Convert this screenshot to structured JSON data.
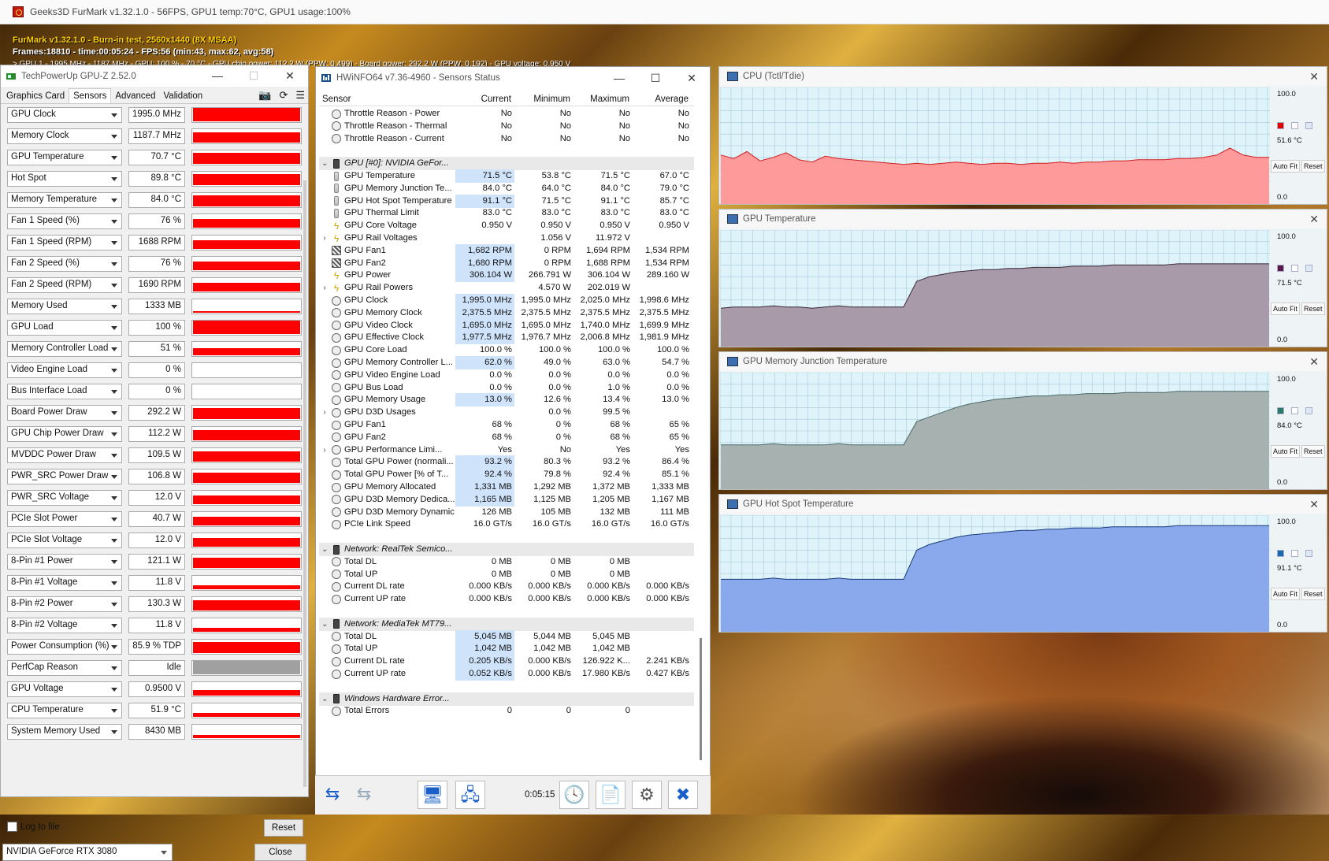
{
  "furmark": {
    "title": "Geeks3D FurMark v1.32.1.0 - 56FPS, GPU1 temp:70°C, GPU1 usage:100%",
    "osd_line1": "FurMark v1.32.1.0 - Burn-in test, 2560x1440 (8X MSAA)",
    "osd_line2": "Frames:18810 - time:00:05:24 - FPS:56 (min:43, max:62, avg:58)",
    "osd_line3": "> GPU 1 - 1995 MHz - 1187 MHz - GPU: 100 % - 70 °C - GPU chip power: 112.2 W (PPW: 0.499) - Board power: 292.2 W (PPW: 0.192) - GPU voltage: 0.950 V"
  },
  "gpuz": {
    "title": "TechPowerUp GPU-Z 2.52.0",
    "tabs": [
      "Graphics Card",
      "Sensors",
      "Advanced",
      "Validation"
    ],
    "sensors": [
      {
        "name": "GPU Clock",
        "value": "1995.0 MHz",
        "level": 0.92,
        "color": "red"
      },
      {
        "name": "Memory Clock",
        "value": "1187.7 MHz",
        "level": 0.7,
        "color": "red"
      },
      {
        "name": "GPU Temperature",
        "value": "70.7 °C",
        "level": 0.75,
        "color": "red"
      },
      {
        "name": "Hot Spot",
        "value": "89.8 °C",
        "level": 0.8,
        "color": "red"
      },
      {
        "name": "Memory Temperature",
        "value": "84.0 °C",
        "level": 0.75,
        "color": "red"
      },
      {
        "name": "Fan 1 Speed (%)",
        "value": "76 %",
        "level": 0.6,
        "color": "red"
      },
      {
        "name": "Fan 1 Speed (RPM)",
        "value": "1688 RPM",
        "level": 0.6,
        "color": "red"
      },
      {
        "name": "Fan 2 Speed (%)",
        "value": "76 %",
        "level": 0.6,
        "color": "red"
      },
      {
        "name": "Fan 2 Speed (RPM)",
        "value": "1690 RPM",
        "level": 0.6,
        "color": "red"
      },
      {
        "name": "Memory Used",
        "value": "1333 MB",
        "level": 0.1,
        "color": "red"
      },
      {
        "name": "GPU Load",
        "value": "100 %",
        "level": 0.92,
        "color": "red"
      },
      {
        "name": "Memory Controller Load",
        "value": "51 %",
        "level": 0.5,
        "color": "red"
      },
      {
        "name": "Video Engine Load",
        "value": "0 %",
        "level": 0.0,
        "color": "red"
      },
      {
        "name": "Bus Interface Load",
        "value": "0 %",
        "level": 0.0,
        "color": "red"
      },
      {
        "name": "Board Power Draw",
        "value": "292.2 W",
        "level": 0.75,
        "color": "red"
      },
      {
        "name": "GPU Chip Power Draw",
        "value": "112.2 W",
        "level": 0.7,
        "color": "red"
      },
      {
        "name": "MVDDC Power Draw",
        "value": "109.5 W",
        "level": 0.7,
        "color": "red"
      },
      {
        "name": "PWR_SRC Power Draw",
        "value": "106.8 W",
        "level": 0.7,
        "color": "red"
      },
      {
        "name": "PWR_SRC Voltage",
        "value": "12.0 V",
        "level": 0.6,
        "color": "red"
      },
      {
        "name": "PCIe Slot Power",
        "value": "40.7 W",
        "level": 0.6,
        "color": "red"
      },
      {
        "name": "PCIe Slot Voltage",
        "value": "12.0 V",
        "level": 0.6,
        "color": "red"
      },
      {
        "name": "8-Pin #1 Power",
        "value": "121.1 W",
        "level": 0.7,
        "color": "red"
      },
      {
        "name": "8-Pin #1 Voltage",
        "value": "11.8 V",
        "level": 0.3,
        "color": "red"
      },
      {
        "name": "8-Pin #2 Power",
        "value": "130.3 W",
        "level": 0.7,
        "color": "red"
      },
      {
        "name": "8-Pin #2 Voltage",
        "value": "11.8 V",
        "level": 0.3,
        "color": "red"
      },
      {
        "name": "Power Consumption (%)",
        "value": "85.9 % TDP",
        "level": 0.75,
        "color": "red"
      },
      {
        "name": "PerfCap Reason",
        "value": "Idle",
        "level": 0.92,
        "color": "gray"
      },
      {
        "name": "GPU Voltage",
        "value": "0.9500 V",
        "level": 0.4,
        "color": "red"
      },
      {
        "name": "CPU Temperature",
        "value": "51.9 °C",
        "level": 0.3,
        "color": "red"
      },
      {
        "name": "System Memory Used",
        "value": "8430 MB",
        "level": 0.2,
        "color": "red"
      }
    ],
    "log_label": "Log to file",
    "reset_label": "Reset",
    "device": "NVIDIA GeForce RTX 3080",
    "close_label": "Close"
  },
  "hwinfo": {
    "title": "HWiNFO64 v7.36-4960 - Sensors Status",
    "columns": [
      "Sensor",
      "Current",
      "Minimum",
      "Maximum",
      "Average"
    ],
    "rows": [
      {
        "t": "row",
        "icon": "circle",
        "n": "Throttle Reason - Power",
        "c": "No",
        "mi": "No",
        "ma": "No",
        "av": "No"
      },
      {
        "t": "row",
        "icon": "circle",
        "n": "Throttle Reason - Thermal",
        "c": "No",
        "mi": "No",
        "ma": "No",
        "av": "No"
      },
      {
        "t": "row",
        "icon": "circle",
        "n": "Throttle Reason - Current",
        "c": "No",
        "mi": "No",
        "ma": "No",
        "av": "No"
      },
      {
        "t": "blank"
      },
      {
        "t": "grp",
        "n": "GPU [#0]: NVIDIA GeFor..."
      },
      {
        "t": "row",
        "icon": "th",
        "n": "GPU Temperature",
        "c": "71.5 °C",
        "mi": "53.8 °C",
        "ma": "71.5 °C",
        "av": "67.0 °C",
        "hl": true
      },
      {
        "t": "row",
        "icon": "th",
        "n": "GPU Memory Junction Te...",
        "c": "84.0 °C",
        "mi": "64.0 °C",
        "ma": "84.0 °C",
        "av": "79.0 °C"
      },
      {
        "t": "row",
        "icon": "th",
        "n": "GPU Hot Spot Temperature",
        "c": "91.1 °C",
        "mi": "71.5 °C",
        "ma": "91.1 °C",
        "av": "85.7 °C",
        "hl": true
      },
      {
        "t": "row",
        "icon": "th",
        "n": "GPU Thermal Limit",
        "c": "83.0 °C",
        "mi": "83.0 °C",
        "ma": "83.0 °C",
        "av": "83.0 °C"
      },
      {
        "t": "row",
        "icon": "bolt",
        "n": "GPU Core Voltage",
        "c": "0.950 V",
        "mi": "0.950 V",
        "ma": "0.950 V",
        "av": "0.950 V"
      },
      {
        "t": "row",
        "icon": "bolt",
        "n": "GPU Rail Voltages",
        "c": "",
        "mi": "1.056 V",
        "ma": "11.972 V",
        "av": "",
        "ex": true
      },
      {
        "t": "row",
        "icon": "fan",
        "n": "GPU Fan1",
        "c": "1,682 RPM",
        "mi": "0 RPM",
        "ma": "1,694 RPM",
        "av": "1,534 RPM",
        "hl": true
      },
      {
        "t": "row",
        "icon": "fan",
        "n": "GPU Fan2",
        "c": "1,680 RPM",
        "mi": "0 RPM",
        "ma": "1,688 RPM",
        "av": "1,534 RPM",
        "hl": true
      },
      {
        "t": "row",
        "icon": "bolt",
        "n": "GPU Power",
        "c": "306.104 W",
        "mi": "266.791 W",
        "ma": "306.104 W",
        "av": "289.160 W",
        "hl": true
      },
      {
        "t": "row",
        "icon": "bolt",
        "n": "GPU Rail Powers",
        "c": "",
        "mi": "4.570 W",
        "ma": "202.019 W",
        "av": "",
        "ex": true
      },
      {
        "t": "row",
        "icon": "circle",
        "n": "GPU Clock",
        "c": "1,995.0 MHz",
        "mi": "1,995.0 MHz",
        "ma": "2,025.0 MHz",
        "av": "1,998.6 MHz",
        "hl": true
      },
      {
        "t": "row",
        "icon": "circle",
        "n": "GPU Memory Clock",
        "c": "2,375.5 MHz",
        "mi": "2,375.5 MHz",
        "ma": "2,375.5 MHz",
        "av": "2,375.5 MHz",
        "hl": true
      },
      {
        "t": "row",
        "icon": "circle",
        "n": "GPU Video Clock",
        "c": "1,695.0 MHz",
        "mi": "1,695.0 MHz",
        "ma": "1,740.0 MHz",
        "av": "1,699.9 MHz",
        "hl": true
      },
      {
        "t": "row",
        "icon": "circle",
        "n": "GPU Effective Clock",
        "c": "1,977.5 MHz",
        "mi": "1,976.7 MHz",
        "ma": "2,006.8 MHz",
        "av": "1,981.9 MHz",
        "hl": true
      },
      {
        "t": "row",
        "icon": "circle",
        "n": "GPU Core Load",
        "c": "100.0 %",
        "mi": "100.0 %",
        "ma": "100.0 %",
        "av": "100.0 %"
      },
      {
        "t": "row",
        "icon": "circle",
        "n": "GPU Memory Controller L...",
        "c": "62.0 %",
        "mi": "49.0 %",
        "ma": "63.0 %",
        "av": "54.7 %",
        "hl": true
      },
      {
        "t": "row",
        "icon": "circle",
        "n": "GPU Video Engine Load",
        "c": "0.0 %",
        "mi": "0.0 %",
        "ma": "0.0 %",
        "av": "0.0 %"
      },
      {
        "t": "row",
        "icon": "circle",
        "n": "GPU Bus Load",
        "c": "0.0 %",
        "mi": "0.0 %",
        "ma": "1.0 %",
        "av": "0.0 %"
      },
      {
        "t": "row",
        "icon": "circle",
        "n": "GPU Memory Usage",
        "c": "13.0 %",
        "mi": "12.6 %",
        "ma": "13.4 %",
        "av": "13.0 %",
        "hl": true
      },
      {
        "t": "row",
        "icon": "circle",
        "n": "GPU D3D Usages",
        "c": "",
        "mi": "0.0 %",
        "ma": "99.5 %",
        "av": "",
        "ex": true
      },
      {
        "t": "row",
        "icon": "circle",
        "n": "GPU Fan1",
        "c": "68 %",
        "mi": "0 %",
        "ma": "68 %",
        "av": "65 %"
      },
      {
        "t": "row",
        "icon": "circle",
        "n": "GPU Fan2",
        "c": "68 %",
        "mi": "0 %",
        "ma": "68 %",
        "av": "65 %"
      },
      {
        "t": "row",
        "icon": "circle",
        "n": "GPU Performance Limi...",
        "c": "Yes",
        "mi": "No",
        "ma": "Yes",
        "av": "Yes",
        "ex": true
      },
      {
        "t": "row",
        "icon": "circle",
        "n": "Total GPU Power (normali...",
        "c": "93.2 %",
        "mi": "80.3 %",
        "ma": "93.2 %",
        "av": "86.4 %",
        "hl": true
      },
      {
        "t": "row",
        "icon": "circle",
        "n": "Total GPU Power [% of T...",
        "c": "92.4 %",
        "mi": "79.8 %",
        "ma": "92.4 %",
        "av": "85.1 %",
        "hl": true
      },
      {
        "t": "row",
        "icon": "circle",
        "n": "GPU Memory Allocated",
        "c": "1,331 MB",
        "mi": "1,292 MB",
        "ma": "1,372 MB",
        "av": "1,333 MB",
        "hl": true
      },
      {
        "t": "row",
        "icon": "circle",
        "n": "GPU D3D Memory Dedica...",
        "c": "1,165 MB",
        "mi": "1,125 MB",
        "ma": "1,205 MB",
        "av": "1,167 MB",
        "hl": true
      },
      {
        "t": "row",
        "icon": "circle",
        "n": "GPU D3D Memory Dynamic",
        "c": "126 MB",
        "mi": "105 MB",
        "ma": "132 MB",
        "av": "111 MB"
      },
      {
        "t": "row",
        "icon": "circle",
        "n": "PCIe Link Speed",
        "c": "16.0 GT/s",
        "mi": "16.0 GT/s",
        "ma": "16.0 GT/s",
        "av": "16.0 GT/s"
      },
      {
        "t": "blank"
      },
      {
        "t": "grp",
        "n": "Network: RealTek Semico..."
      },
      {
        "t": "row",
        "icon": "circle",
        "n": "Total DL",
        "c": "0 MB",
        "mi": "0 MB",
        "ma": "0 MB",
        "av": ""
      },
      {
        "t": "row",
        "icon": "circle",
        "n": "Total UP",
        "c": "0 MB",
        "mi": "0 MB",
        "ma": "0 MB",
        "av": ""
      },
      {
        "t": "row",
        "icon": "circle",
        "n": "Current DL rate",
        "c": "0.000 KB/s",
        "mi": "0.000 KB/s",
        "ma": "0.000 KB/s",
        "av": "0.000 KB/s"
      },
      {
        "t": "row",
        "icon": "circle",
        "n": "Current UP rate",
        "c": "0.000 KB/s",
        "mi": "0.000 KB/s",
        "ma": "0.000 KB/s",
        "av": "0.000 KB/s"
      },
      {
        "t": "blank"
      },
      {
        "t": "grp",
        "n": "Network: MediaTek MT79..."
      },
      {
        "t": "row",
        "icon": "circle",
        "n": "Total DL",
        "c": "5,045 MB",
        "mi": "5,044 MB",
        "ma": "5,045 MB",
        "av": "",
        "hl": true
      },
      {
        "t": "row",
        "icon": "circle",
        "n": "Total UP",
        "c": "1,042 MB",
        "mi": "1,042 MB",
        "ma": "1,042 MB",
        "av": "",
        "hl": true
      },
      {
        "t": "row",
        "icon": "circle",
        "n": "Current DL rate",
        "c": "0.205 KB/s",
        "mi": "0.000 KB/s",
        "ma": "126.922 K...",
        "av": "2.241 KB/s",
        "hl": true
      },
      {
        "t": "row",
        "icon": "circle",
        "n": "Current UP rate",
        "c": "0.052 KB/s",
        "mi": "0.000 KB/s",
        "ma": "17.980 KB/s",
        "av": "0.427 KB/s",
        "hl": true
      },
      {
        "t": "blank"
      },
      {
        "t": "grp",
        "n": "Windows Hardware Error..."
      },
      {
        "t": "row",
        "icon": "circle",
        "n": "Total Errors",
        "c": "0",
        "mi": "0",
        "ma": "0",
        "av": ""
      }
    ],
    "timer": "0:05:15"
  },
  "charts": [
    {
      "title": "CPU (Tctl/Tdie)",
      "top": "100.0",
      "bottom": "0.0",
      "current": "51.6 °C",
      "color": "#ff9a9a",
      "line": "#d02020",
      "swatch": "#e00000",
      "series": [
        42,
        39,
        45,
        37,
        40,
        44,
        38,
        36,
        41,
        39,
        38,
        37,
        36,
        35,
        34,
        35,
        34,
        35,
        36,
        35,
        34,
        35,
        35,
        34,
        35,
        35,
        36,
        35,
        36,
        36,
        37,
        37,
        38,
        38,
        38,
        39,
        39,
        40,
        42,
        48,
        42,
        40,
        40
      ]
    },
    {
      "title": "GPU Temperature",
      "top": "100.0",
      "bottom": "0.0",
      "current": "71.5 °C",
      "color": "#a89aa8",
      "line": "#3a2a3a",
      "swatch": "#5a1a4a",
      "series": [
        33,
        34,
        34,
        34,
        35,
        34,
        34,
        33,
        34,
        35,
        34,
        34,
        34,
        34,
        34,
        56,
        60,
        62,
        64,
        65,
        66,
        66,
        67,
        67,
        68,
        68,
        68,
        69,
        69,
        69,
        70,
        70,
        70,
        70,
        70,
        71,
        71,
        71,
        71,
        71,
        71,
        71,
        71
      ]
    },
    {
      "title": "GPU Memory Junction Temperature",
      "top": "100.0",
      "bottom": "0.0",
      "current": "84.0 °C",
      "color": "#a7b2b0",
      "line": "#4a6a66",
      "swatch": "#2a7a6a",
      "series": [
        38,
        38,
        38,
        38,
        39,
        38,
        38,
        38,
        38,
        39,
        38,
        38,
        38,
        38,
        38,
        58,
        62,
        66,
        70,
        73,
        75,
        77,
        78,
        79,
        80,
        80,
        81,
        81,
        82,
        82,
        82,
        83,
        83,
        83,
        83,
        84,
        84,
        84,
        84,
        84,
        84,
        84,
        84
      ]
    },
    {
      "title": "GPU Hot Spot Temperature",
      "top": "100.0",
      "bottom": "0.0",
      "current": "91.1 °C",
      "color": "#8aa8ec",
      "line": "#1a3a7a",
      "swatch": "#1a6ab0",
      "series": [
        45,
        45,
        45,
        45,
        46,
        45,
        45,
        45,
        45,
        46,
        45,
        45,
        45,
        45,
        45,
        70,
        75,
        78,
        81,
        83,
        84,
        85,
        86,
        87,
        87,
        88,
        88,
        89,
        89,
        89,
        90,
        90,
        90,
        90,
        90,
        91,
        91,
        91,
        91,
        91,
        91,
        91,
        91
      ]
    }
  ],
  "chart_buttons": {
    "autofit": "Auto Fit",
    "reset": "Reset"
  }
}
